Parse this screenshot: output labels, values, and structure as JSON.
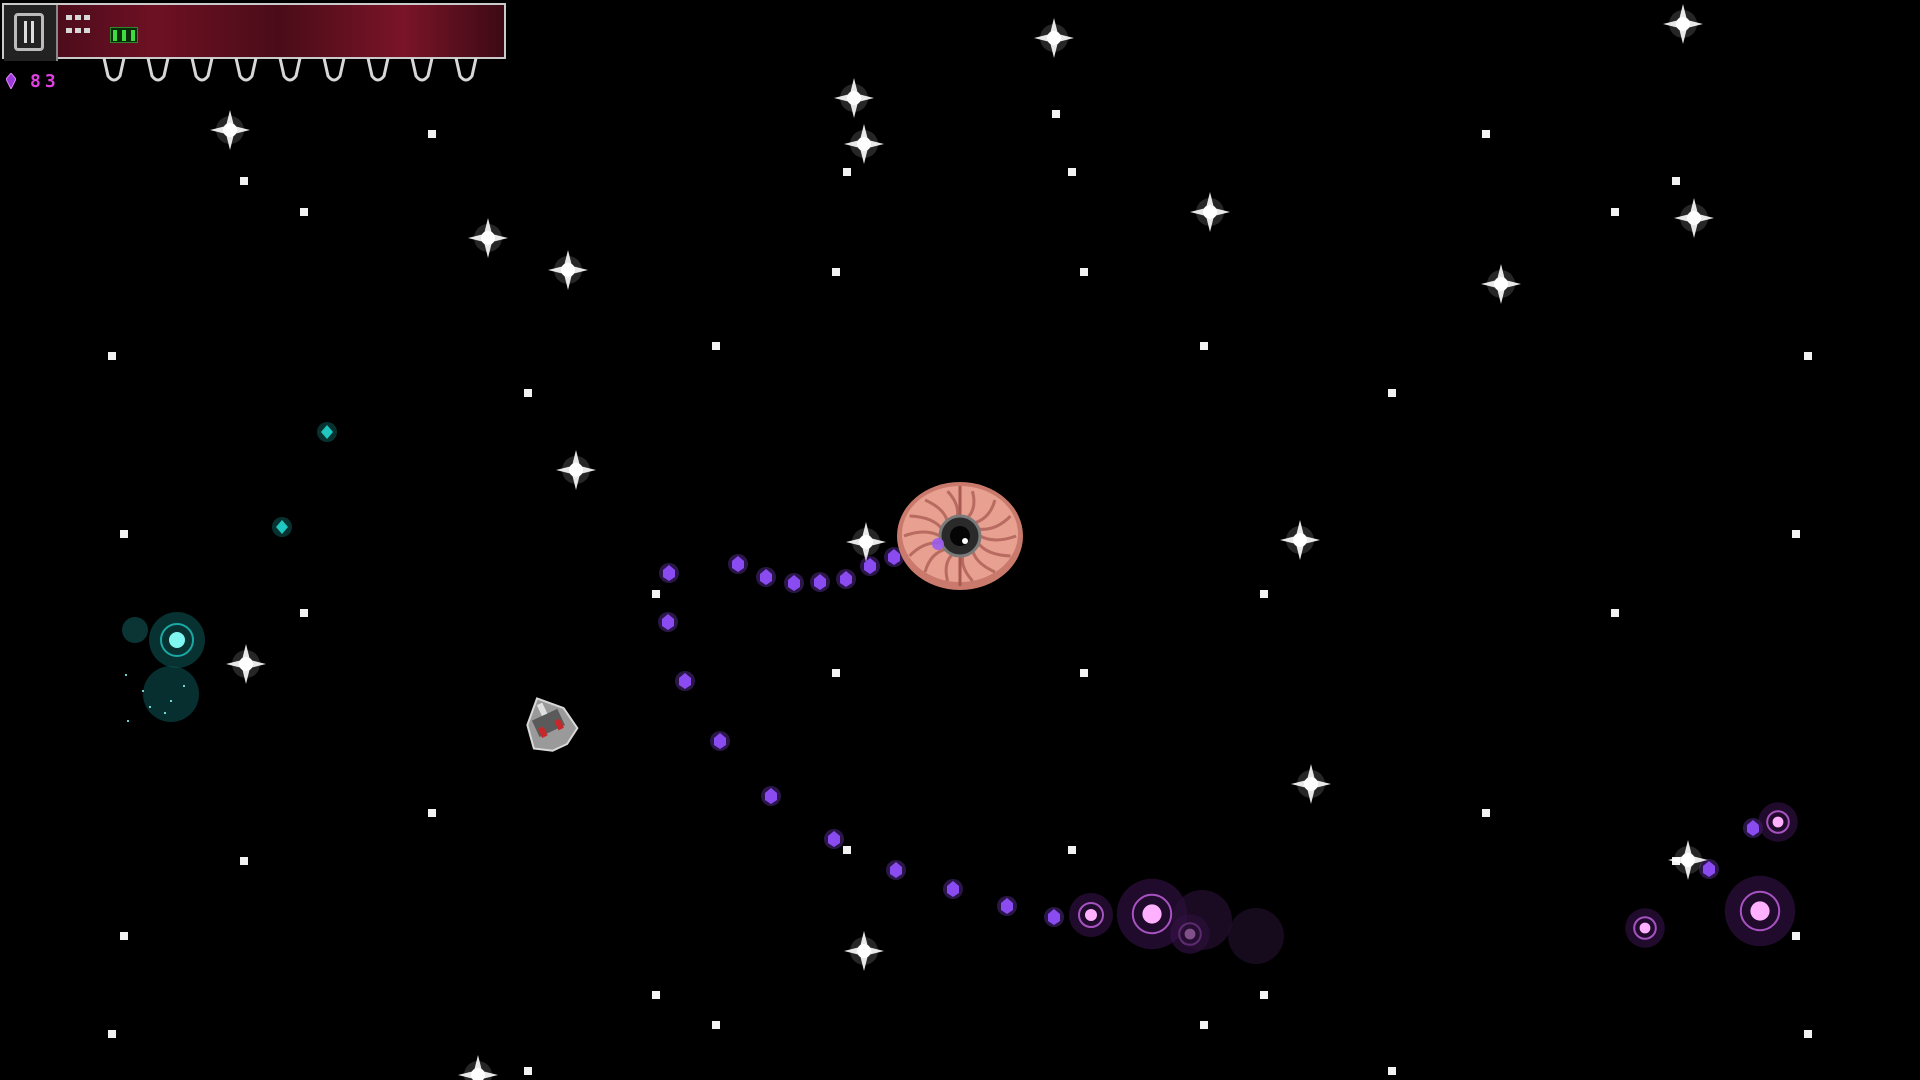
{
  "game": {
    "scene": "space-arena",
    "background_color": "#000000"
  },
  "hud": {
    "portrait_icon": "helmet-portrait-icon",
    "grid_icon": "inventory-grid-icon",
    "status_icon": "green-battery-icon",
    "panel_color": "#6e1024",
    "crystals": {
      "icon": "purple-crystal-icon",
      "count": "83",
      "color": "#e040e0"
    }
  },
  "entities": {
    "boss": {
      "name": "brain-boss",
      "icon": "brain-eye-icon",
      "color": "#e8a090"
    },
    "player": {
      "name": "player-ship",
      "icon": "spaceship-icon",
      "color": "#9a9a9a"
    },
    "projectile_color": "#8a4cf0",
    "teal_pickup_color": "#1fc7c0",
    "pink_orb_color": "#e070ff"
  }
}
